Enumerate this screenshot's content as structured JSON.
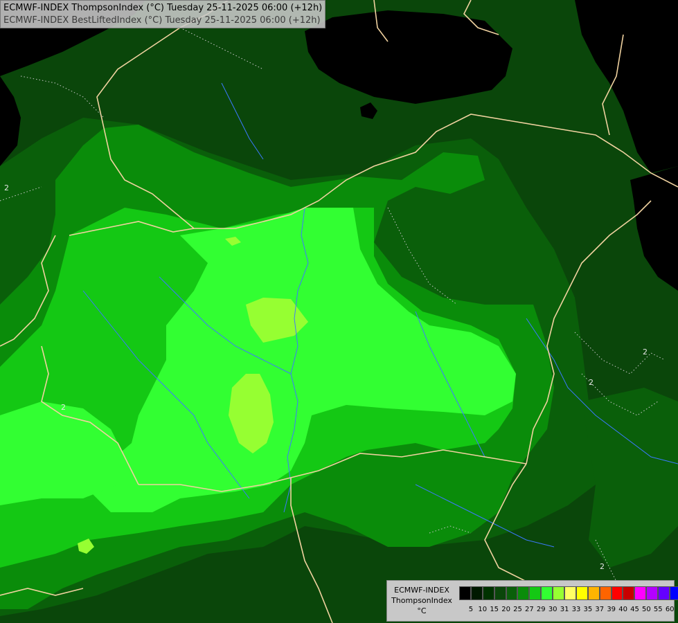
{
  "title": {
    "line1": "ECMWF-INDEX ThompsonIndex (°C) Tuesday 25-11-2025 06:00 (+12h)",
    "line2": "ECMWF-INDEX BestLiftedIndex (°C) Tuesday 25-11-2025 06:00 (+12h)"
  },
  "contour_labels": [
    "2",
    "2",
    "2",
    "2",
    "2"
  ],
  "legend": {
    "line1": "ECMWF-INDEX",
    "line2": "ThompsonIndex",
    "unit": "°C",
    "labels": [
      "5",
      "10",
      "15",
      "20",
      "25",
      "27",
      "29",
      "30",
      "31",
      "33",
      "35",
      "37",
      "39",
      "40",
      "45",
      "50",
      "55",
      "60"
    ],
    "colors": [
      "#000000",
      "#001900",
      "#003200",
      "#0a460a",
      "#0a5f0a",
      "#0a8c0a",
      "#14c814",
      "#32ff32",
      "#96ff32",
      "#ffff64",
      "#ffff00",
      "#ffb400",
      "#ff6400",
      "#ff0000",
      "#c80000",
      "#ff00ff",
      "#b400ff",
      "#6400ff",
      "#0000ff"
    ]
  },
  "map_colors": {
    "black": "#000000",
    "dark_green": "#0a460a",
    "mid_green": "#0a5f0a",
    "green": "#0a8c0a",
    "bright_green": "#14c814",
    "lime": "#32ff32",
    "yellow_green": "#96ff32",
    "border": "#f0d2a0",
    "river": "#3c78ff",
    "contour": "#c8c8c8"
  }
}
